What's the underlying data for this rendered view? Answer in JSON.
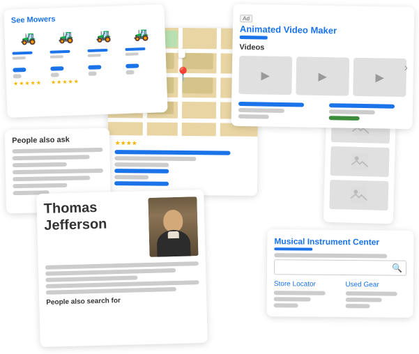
{
  "cards": {
    "mowers": {
      "title": "See Mowers",
      "items": [
        "🚜",
        "🚜",
        "🚜",
        "🚜"
      ]
    },
    "video": {
      "ad_label": "Ad",
      "title": "Animated Video Maker",
      "videos_label": "Videos"
    },
    "map": {
      "map_label": "map pin label"
    },
    "paa": {
      "title": "People also ask"
    },
    "tj": {
      "name": "Thomas Jefferson",
      "paf_title": "People also search for"
    },
    "music": {
      "title": "Musical Instrument Center",
      "store_locator": "Store Locator",
      "used_gear": "Used Gear"
    }
  }
}
